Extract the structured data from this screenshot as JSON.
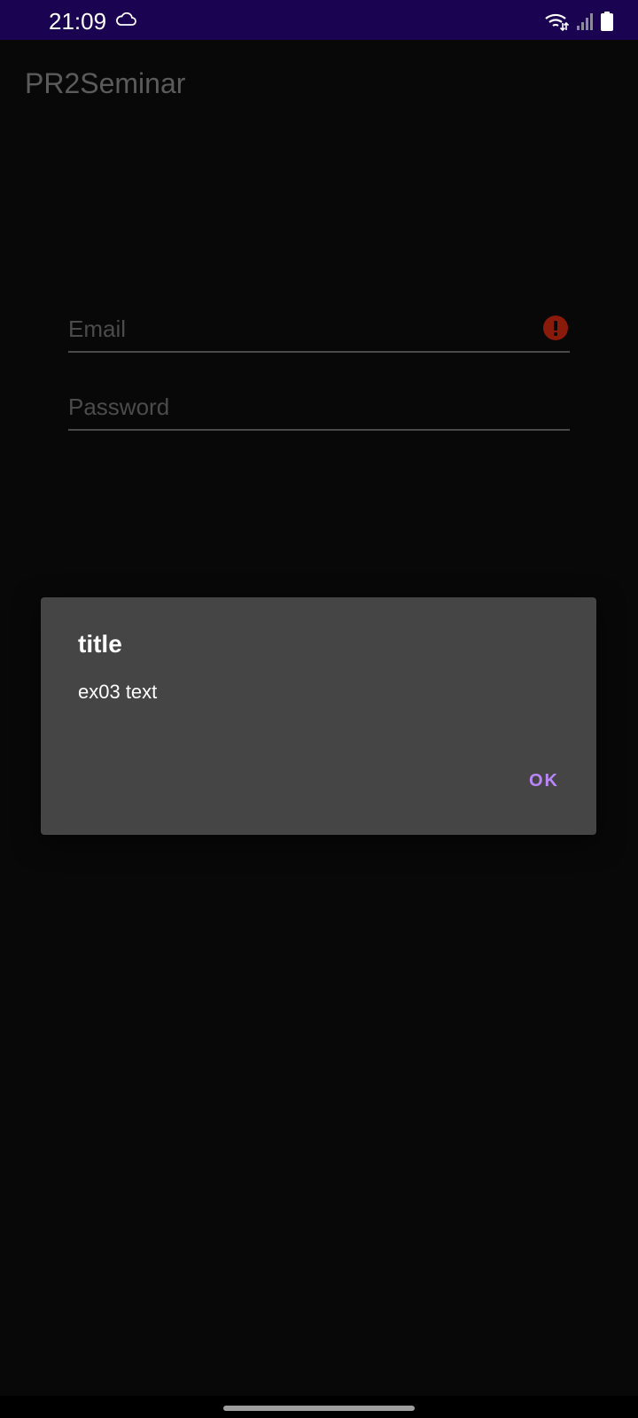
{
  "status_bar": {
    "time": "21:09",
    "background": "#1a0350",
    "icons": [
      "cloud-icon",
      "wifi-icon",
      "signal-icon",
      "battery-icon"
    ]
  },
  "app_bar": {
    "title": "PR2Seminar"
  },
  "form": {
    "email": {
      "placeholder": "Email",
      "has_error": true,
      "error_icon": "error-icon",
      "error_color": "#8a1a0a"
    },
    "password": {
      "placeholder": "Password"
    }
  },
  "dialog": {
    "title": "title",
    "message": "ex03 text",
    "ok_label": "OK",
    "accent_color": "#bb86fc"
  }
}
